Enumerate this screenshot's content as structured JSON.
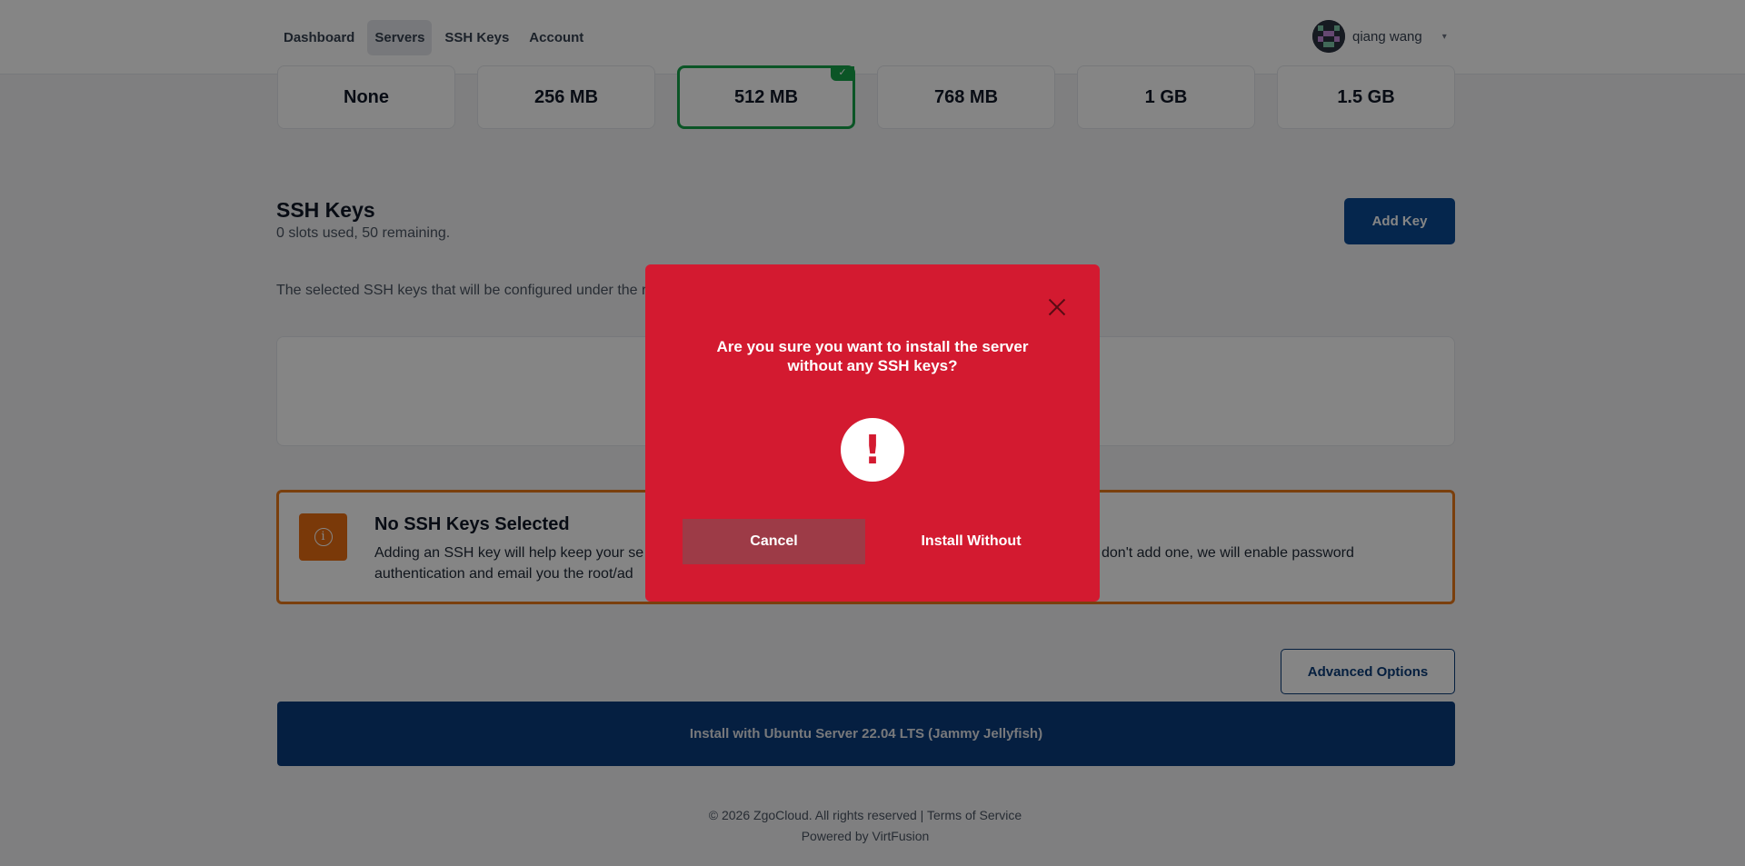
{
  "nav": {
    "links": [
      "Dashboard",
      "Servers",
      "SSH Keys",
      "Account"
    ],
    "user_name": "qiang wang",
    "caret": "▾"
  },
  "memory_options": [
    "None",
    "256 MB",
    "512 MB",
    "768 MB",
    "1 GB",
    "1.5 GB"
  ],
  "memory_selected": "512 MB",
  "ssh": {
    "title": "SSH Keys",
    "subtitle": "0 slots used, 50 remaining.",
    "add_key": "Add Key",
    "description": "The selected SSH keys that will be configured under the r"
  },
  "warning": {
    "title": "No SSH Keys Selected",
    "text_part1": "Adding an SSH key will help keep your se",
    "text_part2": "don't add one, we will enable password",
    "text_line2": "authentication and email you the root/ad"
  },
  "buttons": {
    "advanced": "Advanced Options",
    "install": "Install with Ubuntu Server 22.04 LTS (Jammy Jellyfish)"
  },
  "footer": {
    "copyright": "© 2026 ZgoCloud. All rights reserved |",
    "terms": "Terms of Service",
    "powered": "Powered by VirtFusion"
  },
  "modal": {
    "title": "Are you sure you want to install the server without any SSH keys?",
    "icon": "!",
    "cancel": "Cancel",
    "confirm": "Install Without"
  },
  "colors": {
    "modal_bg": "#d31a30",
    "primary": "#0a3d7e",
    "selected": "#16a34a",
    "warning": "#ea7a1a"
  }
}
